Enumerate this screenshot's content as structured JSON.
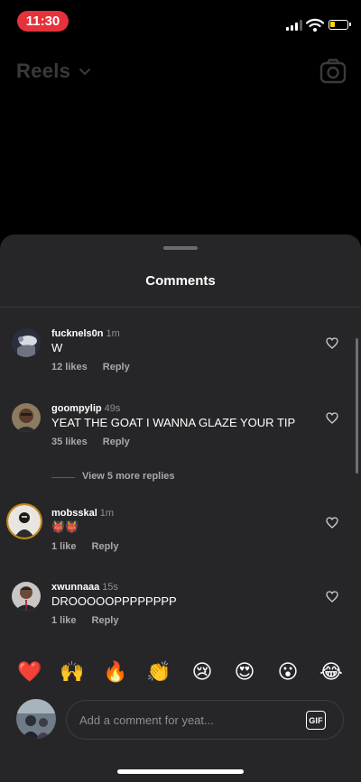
{
  "status_bar": {
    "time": "11:30",
    "time_pill_color": "#e5323b",
    "battery_color": "#ffd60a"
  },
  "header": {
    "title": "Reels",
    "chevron_icon": "chevron-down-icon",
    "camera_icon": "camera-icon"
  },
  "sheet": {
    "title": "Comments"
  },
  "comments": [
    {
      "username": "fucknels0n",
      "time": "1m",
      "text": "W",
      "likes": "12 likes",
      "reply": "Reply",
      "avatar_ring": false
    },
    {
      "username": "goompylip",
      "time": "49s",
      "text": "YEAT THE GOAT I WANNA GLAZE YOUR TIP",
      "likes": "35 likes",
      "reply": "Reply",
      "avatar_ring": false
    },
    {
      "username": "mobsskal",
      "time": "1m",
      "text": "👹👹",
      "likes": "1 like",
      "reply": "Reply",
      "avatar_ring": true
    },
    {
      "username": "xwunnaaa",
      "time": "15s",
      "text": "DROOOOOPPPPPPPP",
      "likes": "1 like",
      "reply": "Reply",
      "avatar_ring": false
    }
  ],
  "view_more_replies": "View 5 more replies",
  "emoji_reactions": [
    "❤️",
    "🙌",
    "🔥",
    "👏",
    "😢",
    "😍",
    "😮",
    "😂"
  ],
  "composer": {
    "placeholder": "Add a comment for yeat...",
    "gif_label": "GIF"
  },
  "colors": {
    "sheet_background": "#262628",
    "story_ring": "#c48b18"
  }
}
